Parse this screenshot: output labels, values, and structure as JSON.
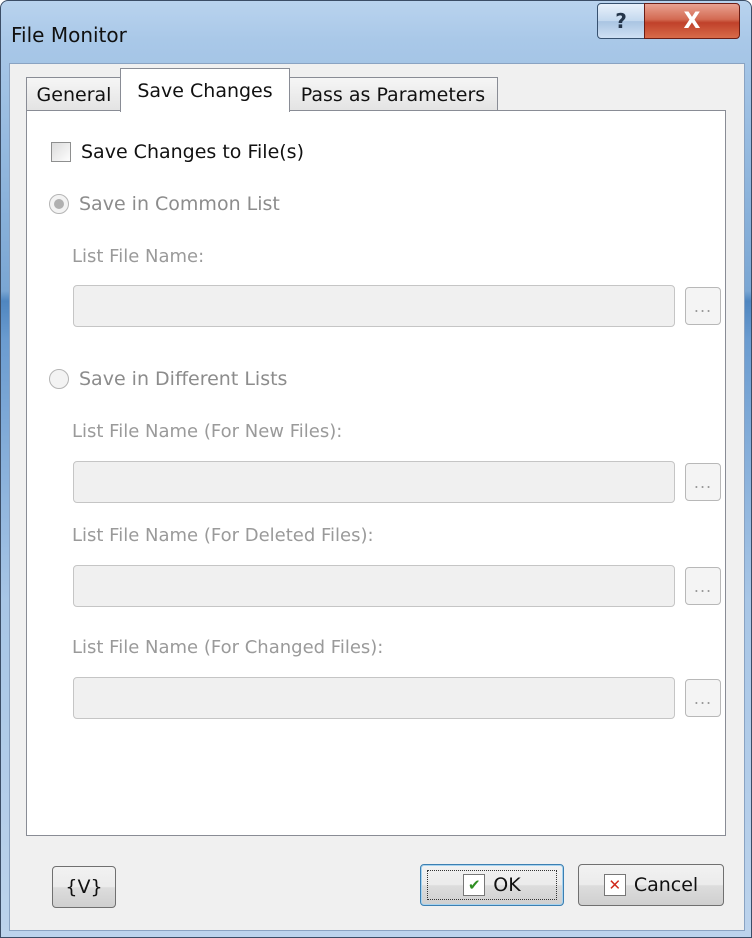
{
  "window": {
    "title": "File Monitor",
    "help_label": "?",
    "close_label": "X"
  },
  "tabs": [
    {
      "label": "General",
      "active": false
    },
    {
      "label": "Save Changes",
      "active": true
    },
    {
      "label": "Pass as Parameters",
      "active": false
    }
  ],
  "save_changes": {
    "save_to_file_label": "Save Changes to File(s)",
    "save_to_file_checked": false,
    "common_list": {
      "label": "Save in Common List",
      "selected": true,
      "field_label": "List File Name:",
      "value": ""
    },
    "different_lists": {
      "label": "Save in Different Lists",
      "selected": false,
      "new_files_label": "List File Name (For New Files):",
      "new_files_value": "",
      "deleted_files_label": "List File Name (For Deleted Files):",
      "deleted_files_value": "",
      "changed_files_label": "List File Name (For Changed Files):",
      "changed_files_value": ""
    },
    "browse_label": "..."
  },
  "footer": {
    "variables_label": "{V}",
    "ok_label": "OK",
    "cancel_label": "Cancel"
  },
  "colors": {
    "disabled_text": "#8c8c8c",
    "ok_check": "#2f8f22",
    "cancel_x": "#d02a1c"
  },
  "icons": {
    "ok": "checkmark-icon",
    "cancel": "x-mark-icon"
  }
}
